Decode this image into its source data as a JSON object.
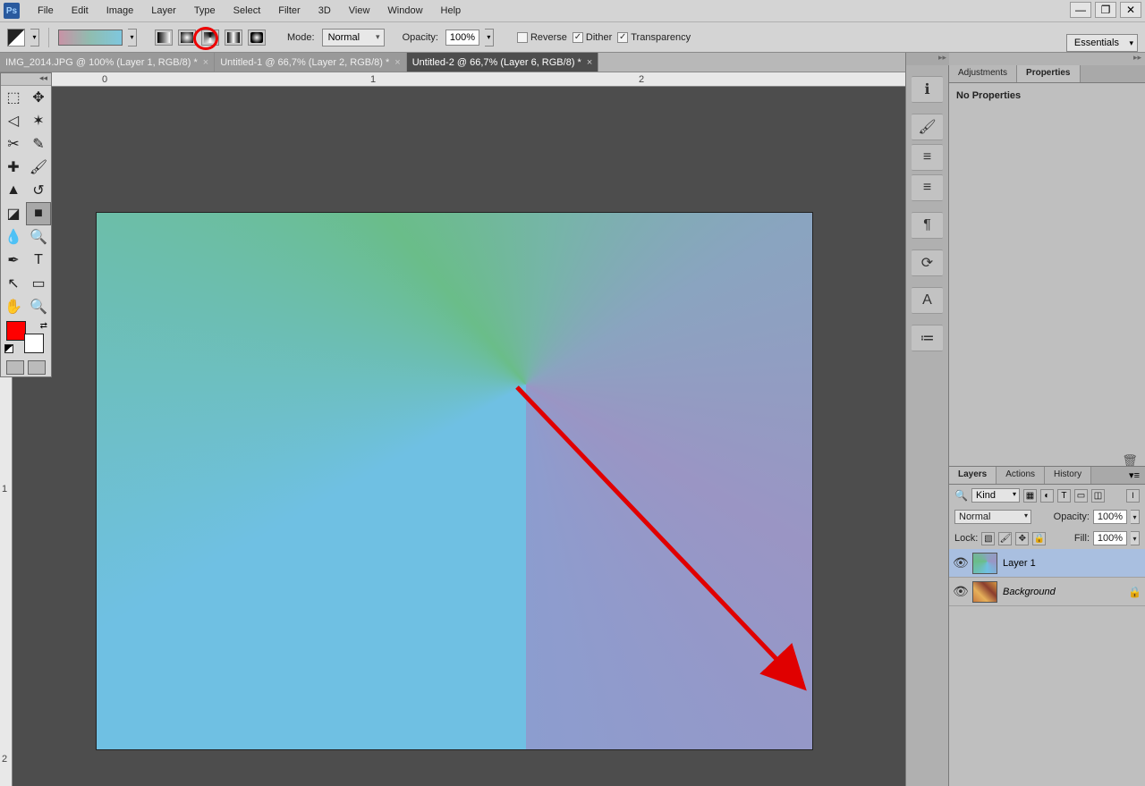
{
  "menu": {
    "items": [
      "File",
      "Edit",
      "Image",
      "Layer",
      "Type",
      "Select",
      "Filter",
      "3D",
      "View",
      "Window",
      "Help"
    ]
  },
  "window": {
    "logo": "Ps"
  },
  "options": {
    "mode_label": "Mode:",
    "mode_value": "Normal",
    "opacity_label": "Opacity:",
    "opacity_value": "100%",
    "reverse_label": "Reverse",
    "dither_label": "Dither",
    "transparency_label": "Transparency"
  },
  "workspace": {
    "value": "Essentials"
  },
  "doc_tabs": [
    {
      "label": "IMG_2014.JPG @ 100% (Layer 1, RGB/8) *",
      "active": false
    },
    {
      "label": "Untitled-1 @ 66,7% (Layer 2, RGB/8) *",
      "active": false
    },
    {
      "label": "Untitled-2 @ 66,7% (Layer 6, RGB/8) *",
      "active": true
    }
  ],
  "ruler": {
    "h": [
      "0",
      "1",
      "2"
    ],
    "v": [
      "1",
      "2"
    ]
  },
  "properties": {
    "tabs": [
      "Adjustments",
      "Properties"
    ],
    "active": "Properties",
    "body": "No Properties"
  },
  "layers_panel": {
    "tabs": [
      "Layers",
      "Actions",
      "History"
    ],
    "active": "Layers",
    "filter_kind": "Kind",
    "blend": "Normal",
    "opacity_label": "Opacity:",
    "opacity_value": "100%",
    "lock_label": "Lock:",
    "fill_label": "Fill:",
    "fill_value": "100%",
    "layers": [
      {
        "name": "Layer 1",
        "selected": true,
        "locked": false,
        "thumb": "grad"
      },
      {
        "name": "Background",
        "selected": false,
        "locked": true,
        "thumb": "bg",
        "italic": true
      }
    ]
  },
  "icon_strip": [
    "ℹ",
    "🖌",
    "≡",
    "≡",
    "¶",
    "⟳",
    "A",
    "≔"
  ],
  "tool_icons": [
    "▭",
    "↖",
    "◿",
    "✶",
    "✂",
    "✎",
    "⊞",
    "🖌",
    "▲",
    "🖍",
    "💧",
    "■",
    "💧",
    "🔍",
    "✒",
    "T",
    "↖",
    "▭",
    "✋",
    "🔍"
  ]
}
